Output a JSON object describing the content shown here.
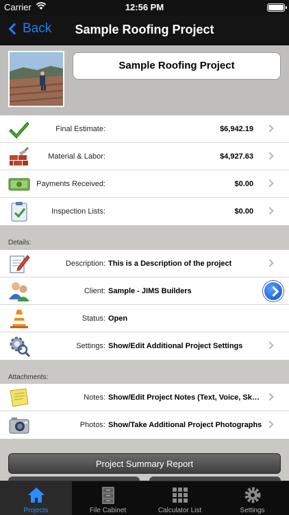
{
  "status_bar": {
    "carrier": "Carrier",
    "time": "12:56 PM"
  },
  "nav": {
    "back_label": "Back",
    "title": "Sample Roofing Project"
  },
  "project": {
    "name": "Sample Roofing Project"
  },
  "financials": [
    {
      "icon": "checkmark-icon",
      "label": "Final Estimate:",
      "value": "$6,942.19"
    },
    {
      "icon": "bricks-trowel-icon",
      "label": "Material & Labor:",
      "value": "$4,927.63"
    },
    {
      "icon": "cash-icon",
      "label": "Payments Received:",
      "value": "$0.00"
    },
    {
      "icon": "clipboard-icon",
      "label": "Inspection Lists:",
      "value": "$0.00"
    }
  ],
  "details": {
    "section_label": "Details:",
    "rows": [
      {
        "icon": "pencil-paper-icon",
        "label": "Description:",
        "value": "This is a Description of the project"
      },
      {
        "icon": "people-icon",
        "label": "Client:",
        "value": "Sample - JIMS Builders"
      },
      {
        "icon": "traffic-cone-icon",
        "label": "Status:",
        "value": "Open"
      },
      {
        "icon": "gear-magnifier-icon",
        "label": "Settings:",
        "value": "Show/Edit Additional Project Settings"
      }
    ]
  },
  "attachments": {
    "section_label": "Attachments:",
    "rows": [
      {
        "icon": "sticky-note-icon",
        "label": "Notes:",
        "value": "Show/Edit Project Notes (Text, Voice, Sketch..."
      },
      {
        "icon": "camera-icon",
        "label": "Photos:",
        "value": "Show/Take Additional Project Photographs"
      }
    ]
  },
  "summary_button": "Project Summary Report",
  "tabs": [
    {
      "icon": "home-icon",
      "label": "Projects",
      "active": true
    },
    {
      "icon": "file-cabinet-icon",
      "label": "File Cabinet",
      "active": false
    },
    {
      "icon": "grid-icon",
      "label": "Calculator List",
      "active": false
    },
    {
      "icon": "gear-icon",
      "label": "Settings",
      "active": false
    }
  ],
  "colors": {
    "accent": "#2d8cff",
    "nav_bg": "#141414",
    "background": "#c9c8c5"
  }
}
